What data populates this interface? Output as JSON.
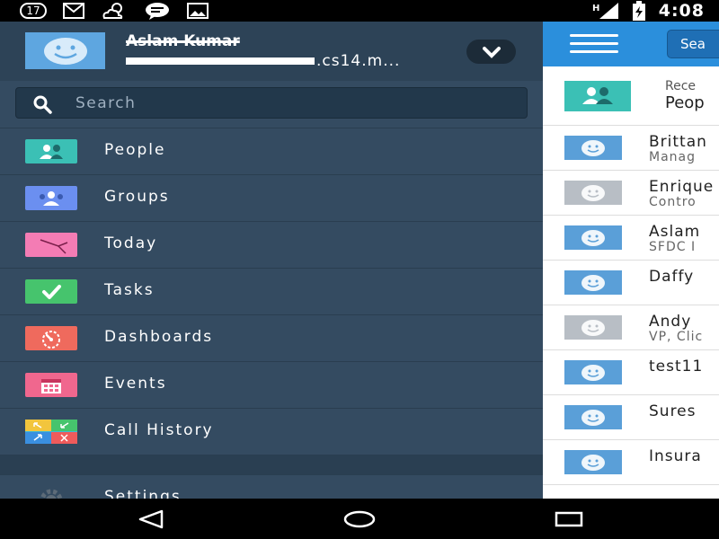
{
  "status_bar": {
    "notification_count": "17",
    "time": "4:08",
    "network_label": "H",
    "icons": [
      "notification-count-icon",
      "gmail-icon",
      "weather-icon",
      "chat-icon",
      "image-icon",
      "signal-icon",
      "battery-charging-icon"
    ]
  },
  "drawer": {
    "user": {
      "name": "Aslam Kumar",
      "domain_suffix": ".cs14.m...",
      "avatar_icon": "smiley-avatar-icon",
      "expand_icon": "chevron-down-icon"
    },
    "search": {
      "placeholder": "Search",
      "value": ""
    },
    "menu": [
      {
        "label": "People",
        "icon": "people-icon",
        "color": "#3bc0b5"
      },
      {
        "label": "Groups",
        "icon": "groups-icon",
        "color": "#6b8ff0"
      },
      {
        "label": "Today",
        "icon": "today-icon",
        "color": "#f47cb4"
      },
      {
        "label": "Tasks",
        "icon": "tasks-check-icon",
        "color": "#46c46d"
      },
      {
        "label": "Dashboards",
        "icon": "dashboard-gauge-icon",
        "color": "#ef6a5d"
      },
      {
        "label": "Events",
        "icon": "calendar-icon",
        "color": "#f0678e"
      },
      {
        "label": "Call History",
        "icon": "call-history-icon",
        "color": "#3fb8d6"
      },
      {
        "label": "Settings",
        "icon": "gear-icon",
        "color": "#5d6b78"
      }
    ]
  },
  "main": {
    "search_button_label": "Sea",
    "recent": {
      "small": "Rece",
      "big": "Peop"
    },
    "list": [
      {
        "name": "Brittan",
        "sub": "Manag",
        "avatar": "blue"
      },
      {
        "name": "Enrique",
        "sub": "Contro",
        "avatar": "grey"
      },
      {
        "name": "Aslam",
        "sub": "SFDC I",
        "avatar": "blue"
      },
      {
        "name": "Daffy",
        "sub": "",
        "avatar": "blue"
      },
      {
        "name": "Andy",
        "sub": "VP, Clic",
        "avatar": "grey"
      },
      {
        "name": "test11",
        "sub": "",
        "avatar": "blue"
      },
      {
        "name": "Sures",
        "sub": "",
        "avatar": "blue"
      },
      {
        "name": "Insura",
        "sub": "",
        "avatar": "blue"
      }
    ]
  },
  "colors": {
    "drawer_bg": "#344b61",
    "header_bg": "#2d4357",
    "accent_blue": "#2b8fdc"
  }
}
